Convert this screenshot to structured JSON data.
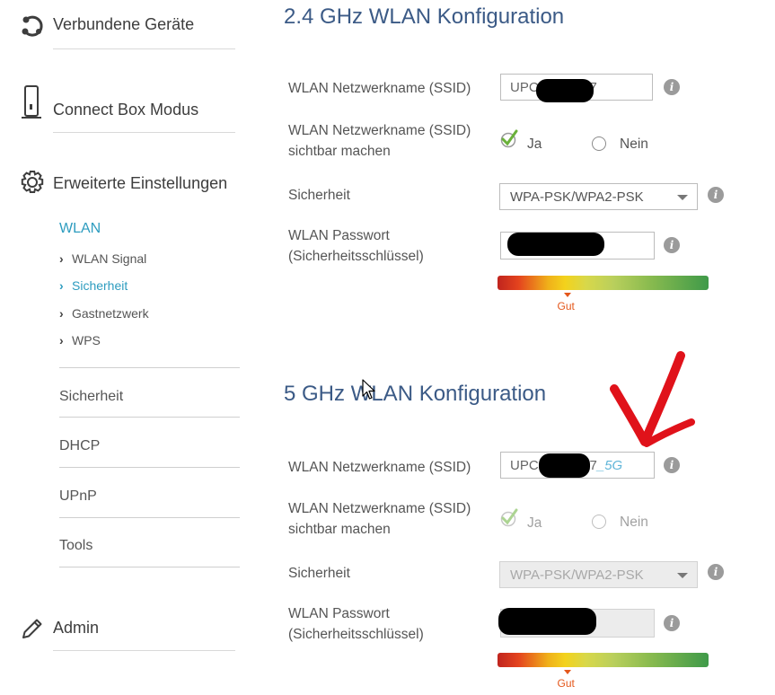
{
  "sidebar": {
    "main_items": [
      {
        "label": "Verbundene Geräte",
        "icon": "connected-devices-icon"
      },
      {
        "label": "Connect Box Modus",
        "icon": "modem-icon"
      },
      {
        "label": "Erweiterte Einstellungen",
        "icon": "gear-icon"
      },
      {
        "label": "Admin",
        "icon": "pencil-icon"
      }
    ],
    "wlan_heading": "WLAN",
    "wlan_subitems": [
      {
        "label": "WLAN Signal",
        "active": false
      },
      {
        "label": "Sicherheit",
        "active": true
      },
      {
        "label": "Gastnetzwerk",
        "active": false
      },
      {
        "label": "WPS",
        "active": false
      }
    ],
    "sections": [
      "Sicherheit",
      "DHCP",
      "UPnP",
      "Tools"
    ]
  },
  "wlan24": {
    "title": "2.4 GHz WLAN Konfiguration",
    "ssid_label": "WLAN Netzwerkname (SSID)",
    "ssid_prefix": "UPC",
    "ssid_suffix": "D7",
    "visible_label_1": "WLAN Netzwerkname (SSID)",
    "visible_label_2": "sichtbar machen",
    "radio_yes": "Ja",
    "radio_no": "Nein",
    "selected": "Ja",
    "security_label": "Sicherheit",
    "security_value": "WPA-PSK/WPA2-PSK",
    "password_label_1": "WLAN Passwort",
    "password_label_2": "(Sicherheitsschlüssel)",
    "strength_label": "Gut",
    "strength_fraction": 0.33
  },
  "wlan5": {
    "title": "5 GHz WLAN Konfiguration",
    "ssid_label": "WLAN Netzwerkname (SSID)",
    "ssid_prefix": "UPC",
    "ssid_suffix": "D7_5G",
    "visible_label_1": "WLAN Netzwerkname (SSID)",
    "visible_label_2": "sichtbar machen",
    "radio_yes": "Ja",
    "radio_no": "Nein",
    "selected": "Ja",
    "security_label": "Sicherheit",
    "security_value": "WPA-PSK/WPA2-PSK",
    "password_label_1": "WLAN Passwort",
    "password_label_2": "(Sicherheitsschlüssel)",
    "strength_label": "Gut",
    "strength_fraction": 0.33
  },
  "colors": {
    "accent": "#2d9cbf",
    "title": "#3b5a86",
    "annotation": "#e0121a",
    "gut": "#e4571b"
  }
}
